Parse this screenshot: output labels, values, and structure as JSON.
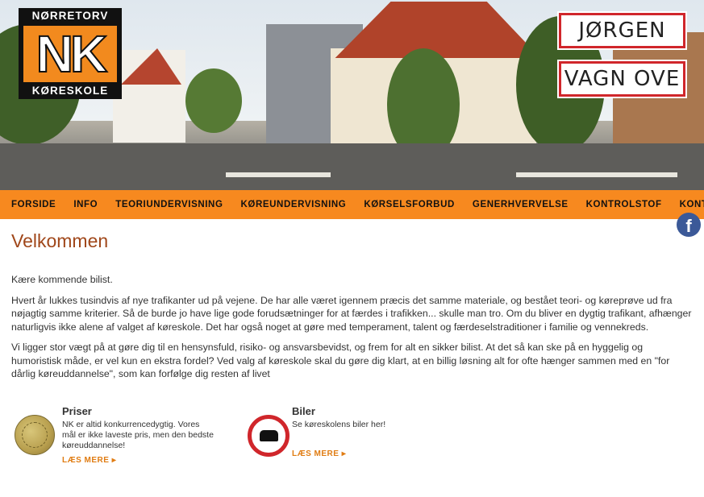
{
  "logo": {
    "top": "NØRRETORV",
    "mark": "NK",
    "bottom": "KØRESKOLE"
  },
  "signs": {
    "first": "JØRGEN",
    "second": "VAGN OVE"
  },
  "nav": [
    "FORSIDE",
    "INFO",
    "TEORIUNDERVISNING",
    "KØREUNDERVISNING",
    "KØRSELSFORBUD",
    "GENERHVERVELSE",
    "KONTROLSTOF",
    "KONTAKT"
  ],
  "page": {
    "title": "Velkommen",
    "paragraphs": [
      "Kære kommende bilist.",
      "Hvert år lukkes tusindvis af nye trafikanter ud på vejene. De har alle været igennem præcis det samme materiale, og bestået teori- og køreprøve ud fra nøjagtig samme kriterier. Så de burde jo have lige gode forudsætninger for at færdes i trafikken... skulle man tro. Om du bliver en dygtig trafikant, afhænger naturligvis ikke alene af valget af køreskole. Det har også noget at gøre med temperament, talent og færdeselstraditioner i familie og vennekreds.",
      "Vi ligger stor vægt på at gøre dig til en hensynsfuld, risiko- og ansvarsbevidst, og frem for alt en sikker bilist. At det så kan ske på en hyggelig og humoristisk måde, er vel kun en ekstra fordel? Ved valg af køreskole skal du gøre dig klart, at en billig løsning alt for ofte hænger sammen med en \"for dårlig køreuddannelse\", som kan forfølge dig resten af livet"
    ]
  },
  "social": {
    "facebook_glyph": "f"
  },
  "features": [
    {
      "title": "Priser",
      "text": "NK er altid konkurrencedygtig. Vores mål er ikke laveste pris, men den bedste køreuddannelse!",
      "more": "LÆS MERE",
      "icon": "coin-icon"
    },
    {
      "title": "Biler",
      "text": "Se køreskolens biler her!",
      "more": "LÆS MERE",
      "icon": "no-car-sign-icon"
    }
  ],
  "colors": {
    "accent": "#f7891f",
    "heading": "#a0471a",
    "sign_border": "#d0262b",
    "link": "#e07c12"
  }
}
